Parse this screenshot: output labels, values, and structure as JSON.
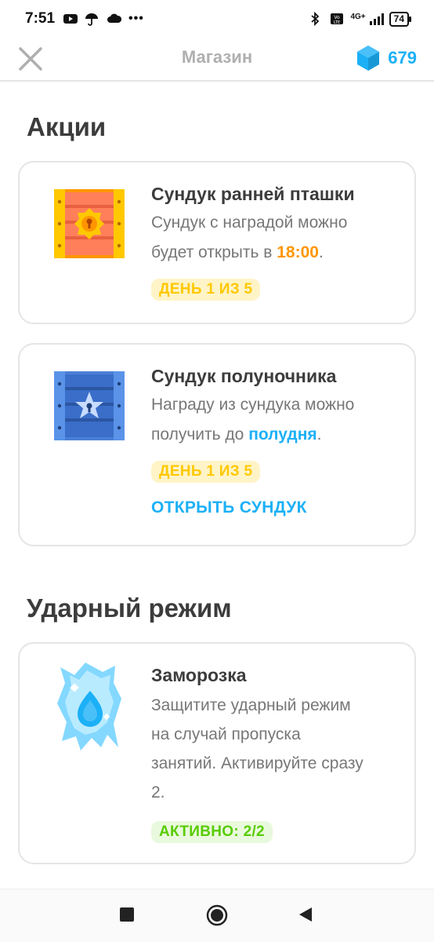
{
  "status_bar": {
    "time": "7:51",
    "dots": "•••",
    "network": "4G+",
    "battery": "74",
    "icons": [
      "youtube-icon",
      "umbrella-icon",
      "cloud-icon",
      "bluetooth-icon",
      "volte-icon",
      "signal-icon",
      "battery-icon"
    ]
  },
  "header": {
    "title": "Магазин",
    "gems": "679",
    "icons": [
      "close-icon",
      "gem-icon"
    ]
  },
  "sections": [
    {
      "title": "Акции",
      "items": [
        {
          "title": "Сундук ранней пташки",
          "desc_line1": "Сундук с наградой можно",
          "desc_line2_prefix": "будет открыть в ",
          "desc_highlight": "18:00",
          "desc_suffix": ".",
          "badge": "ДЕНЬ 1 ИЗ 5",
          "icon": "orange-chest-icon"
        },
        {
          "title": "Сундук полуночника",
          "desc_line1": "Награду из сундука можно",
          "desc_line2_prefix": "получить до ",
          "desc_highlight": "полудня",
          "desc_suffix": ".",
          "badge": "ДЕНЬ 1 ИЗ 5",
          "action": "ОТКРЫТЬ СУНДУК",
          "icon": "blue-chest-icon"
        }
      ]
    },
    {
      "title": "Ударный режим",
      "items": [
        {
          "title": "Заморозка",
          "desc_lines": [
            "Защитите ударный режим",
            "на случай пропуска",
            "занятий. Активируйте сразу",
            "2."
          ],
          "badge": "АКТИВНО: 2/2",
          "icon": "ice-freeze-icon"
        }
      ]
    }
  ],
  "nav": {
    "icons": [
      "recents-square-icon",
      "home-circle-icon",
      "back-triangle-icon"
    ]
  },
  "colors": {
    "accent_blue": "#1cb0f6",
    "orange": "#ff9600",
    "badge_yellow_bg": "#fff4c7",
    "badge_yellow_text": "#ffc800",
    "badge_green_bg": "#e9f9dd",
    "badge_green_text": "#58cc02",
    "border": "#e5e5e5"
  }
}
